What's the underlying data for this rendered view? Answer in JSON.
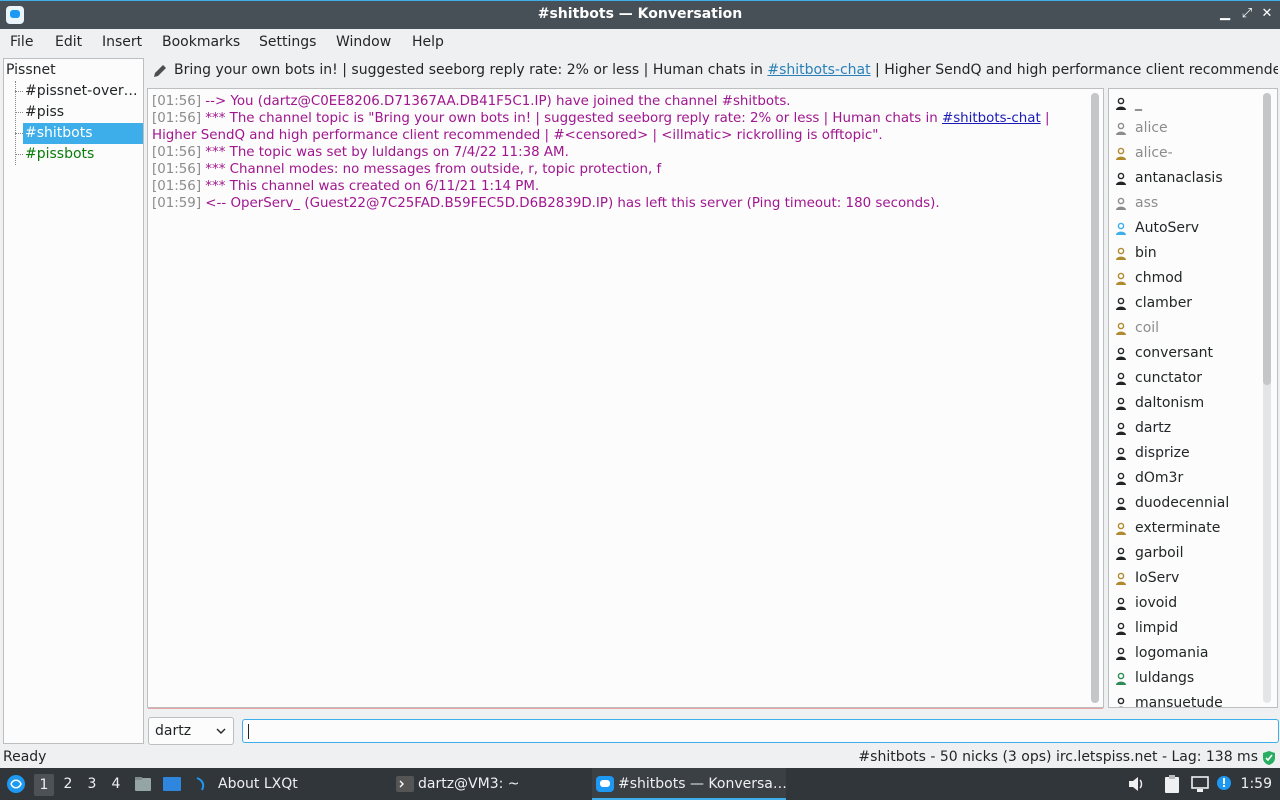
{
  "window": {
    "title": "#shitbots — Konversation"
  },
  "menu": [
    "File",
    "Edit",
    "Insert",
    "Bookmarks",
    "Settings",
    "Window",
    "Help"
  ],
  "tree": {
    "server": "Pissnet",
    "channels": [
      {
        "label": "#pissnet-over…",
        "color": "#232627"
      },
      {
        "label": "#piss",
        "color": "#232627"
      },
      {
        "label": "#shitbots",
        "color": "#ffffff",
        "selected": true
      },
      {
        "label": "#pissbots",
        "color": "#0a7c0a"
      }
    ]
  },
  "topic": {
    "part1": "Bring your own bots in! | suggested seeborg reply rate: 2% or less | Human chats in ",
    "link": "#shitbots-chat",
    "part2": " | Higher SendQ and high performance client recommended | ..."
  },
  "chat": [
    {
      "ts": "[01:56]",
      "pre": " --> You (dartz@C0EE8206.D71367AA.DB41F5C1.IP) have joined the channel #shitbots.",
      "link": "",
      "post": ""
    },
    {
      "ts": "[01:56]",
      "pre": " *** The channel topic is \"Bring your own bots in! | suggested seeborg reply rate: 2% or less | Human chats in ",
      "link": "#shitbots-chat",
      "post": " |"
    },
    {
      "ts": "",
      "pre": "Higher SendQ and high performance client recommended | #<censored> | <illmatic> rickrolling is offtopic\".",
      "link": "",
      "post": ""
    },
    {
      "ts": "[01:56]",
      "pre": " *** The topic was set by luldangs on 7/4/22 11:38 AM.",
      "link": "",
      "post": ""
    },
    {
      "ts": "[01:56]",
      "pre": " *** Channel modes: no messages from outside, r, topic protection, f",
      "link": "",
      "post": ""
    },
    {
      "ts": "[01:56]",
      "pre": " *** This channel was created on 6/11/21 1:14 PM.",
      "link": "",
      "post": ""
    },
    {
      "ts": "[01:59]",
      "pre": " <-- OperServ_ (Guest22@7C25FAD.B59FEC5D.D6B2839D.IP) has left this server (Ping timeout: 180 seconds).",
      "link": "",
      "post": ""
    }
  ],
  "nicks": [
    {
      "name": "_",
      "color": "#232627",
      "icon": "#232627"
    },
    {
      "name": "alice",
      "color": "#8c8c8c",
      "icon": "#8c8c8c"
    },
    {
      "name": "alice-",
      "color": "#8c8c8c",
      "icon": "#b08a2e"
    },
    {
      "name": "antanaclasis",
      "color": "#232627",
      "icon": "#232627"
    },
    {
      "name": "ass",
      "color": "#8c8c8c",
      "icon": "#8c8c8c"
    },
    {
      "name": "AutoServ",
      "color": "#232627",
      "icon": "#3daee9"
    },
    {
      "name": "bin",
      "color": "#232627",
      "icon": "#b08a2e"
    },
    {
      "name": "chmod",
      "color": "#232627",
      "icon": "#b08a2e"
    },
    {
      "name": "clamber",
      "color": "#232627",
      "icon": "#232627"
    },
    {
      "name": "coil",
      "color": "#8c8c8c",
      "icon": "#b08a2e"
    },
    {
      "name": "conversant",
      "color": "#232627",
      "icon": "#232627"
    },
    {
      "name": "cunctator",
      "color": "#232627",
      "icon": "#232627"
    },
    {
      "name": "daltonism",
      "color": "#232627",
      "icon": "#232627"
    },
    {
      "name": "dartz",
      "color": "#232627",
      "icon": "#232627"
    },
    {
      "name": "disprize",
      "color": "#232627",
      "icon": "#232627"
    },
    {
      "name": "dOm3r",
      "color": "#232627",
      "icon": "#232627"
    },
    {
      "name": "duodecennial",
      "color": "#232627",
      "icon": "#232627"
    },
    {
      "name": "exterminate",
      "color": "#232627",
      "icon": "#b08a2e"
    },
    {
      "name": "garboil",
      "color": "#232627",
      "icon": "#232627"
    },
    {
      "name": "IoServ",
      "color": "#232627",
      "icon": "#b08a2e"
    },
    {
      "name": "iovoid",
      "color": "#232627",
      "icon": "#232627"
    },
    {
      "name": "limpid",
      "color": "#232627",
      "icon": "#232627"
    },
    {
      "name": "logomania",
      "color": "#232627",
      "icon": "#232627"
    },
    {
      "name": "luldangs",
      "color": "#232627",
      "icon": "#2e8b57"
    },
    {
      "name": "mansuetude",
      "color": "#232627",
      "icon": "#232627"
    }
  ],
  "input": {
    "nick": "dartz",
    "value": ""
  },
  "status": {
    "left": "Ready",
    "right": "#shitbots - 50 nicks (3 ops)  irc.letspiss.net - Lag: 138 ms"
  },
  "taskbar": {
    "workspaces": [
      "1",
      "2",
      "3",
      "4"
    ],
    "tasks": [
      "About LXQt",
      "dartz@VM3: ~",
      "#shitbots — Konversa…"
    ],
    "clock": "1:59"
  },
  "colors": {
    "accent": "#3daee9",
    "chat_text": "#a0168f",
    "timestamp": "#8c8c8c",
    "selection": "#3daee9"
  }
}
